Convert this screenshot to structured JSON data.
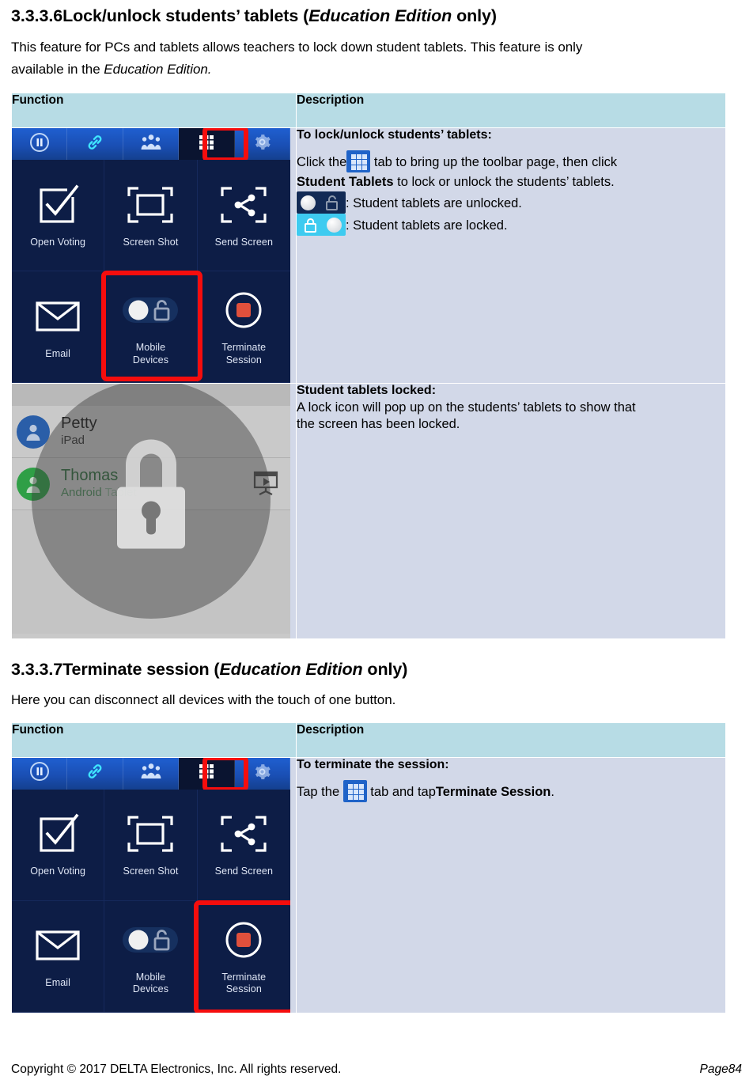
{
  "sections": [
    {
      "number": "3.3.3.6",
      "title_plain_1": "Lock/unlock students’ tablets (",
      "title_italic": "Education Edition",
      "title_plain_2": " only)",
      "intro_line_1": "This feature for PCs and tablets allows teachers to lock down student tablets. This feature is only",
      "intro_line_2_pre": "available in the ",
      "intro_line_2_italic": "Education Edition."
    },
    {
      "number": "3.3.3.7",
      "title_plain_1": "Terminate session (",
      "title_italic": "Education Edition",
      "title_plain_2": " only)",
      "intro_line_1": "Here you can disconnect all devices with the touch of one button.",
      "intro_line_2_pre": "",
      "intro_line_2_italic": ""
    }
  ],
  "table": {
    "header_function": "Function",
    "header_description": "Description"
  },
  "row_lock": {
    "desc_title": "To lock/unlock students’ tablets:",
    "line1_pre": "Click the",
    "line1_post": " tab to bring up the toolbar page, then click",
    "line2_bold": "Student Tablets",
    "line2_rest": " to lock or unlock the students’ tablets.",
    "unlocked_text": ": Student tablets are unlocked.",
    "locked_text": ": Student tablets are locked."
  },
  "row_locked_state": {
    "desc_title": "Student tablets locked:",
    "line1": "A lock icon will pop up on the students’ tablets to show that",
    "line2": "the screen has been locked."
  },
  "row_terminate": {
    "desc_title": "To terminate the session:",
    "line1_pre": "Tap the ",
    "line1_mid": " tab and tap",
    "line1_bold": "Terminate Session",
    "line1_end": "."
  },
  "toolbar_screenshot": {
    "nav_icons": [
      "pause-icon",
      "link-icon",
      "group-icon",
      "apps-grid-icon",
      "gear-icon"
    ],
    "tiles": [
      {
        "label": "Open Voting",
        "icon": "checkbox-icon"
      },
      {
        "label": "Screen Shot",
        "icon": "screenshot-frame-icon"
      },
      {
        "label": "Send Screen",
        "icon": "share-frame-icon"
      },
      {
        "label": "Email",
        "icon": "envelope-icon"
      },
      {
        "label": "Mobile\nDevices",
        "label_line1": "Mobile",
        "label_line2": "Devices",
        "icon": "lock-toggle-icon"
      },
      {
        "label": "Terminate\nSession",
        "label_line1": "Terminate",
        "label_line2": "Session",
        "icon": "stop-record-icon"
      }
    ],
    "highlight_lock": [
      "apps-grid-icon",
      "mobile-devices-tile"
    ],
    "highlight_terminate": [
      "apps-grid-icon",
      "terminate-session-tile"
    ]
  },
  "locked_list_screenshot": {
    "students": [
      {
        "name": "Petty",
        "device": "iPad",
        "avatar_color": "#2a5ea8"
      },
      {
        "name": "Thomas",
        "device_strong": "Android",
        "device_faint": " Tablet",
        "avatar_color": "#2f9f46"
      }
    ],
    "overlay_icon": "padlock-icon",
    "present_icon": "present-screen-icon"
  },
  "footer": {
    "copyright": "Copyright © 2017 DELTA Electronics, Inc. All rights reserved.",
    "page_label": "Page",
    "page_number": "84"
  },
  "colors": {
    "table_header": "#b7dce5",
    "table_cell": "#d2d8e8",
    "highlight_red": "#f50d0d",
    "toolbar_dark": "#0d1d46",
    "toolbar_nav_blue": "#1a4fb4",
    "toggle_locked_cyan": "#3ecbf0"
  }
}
